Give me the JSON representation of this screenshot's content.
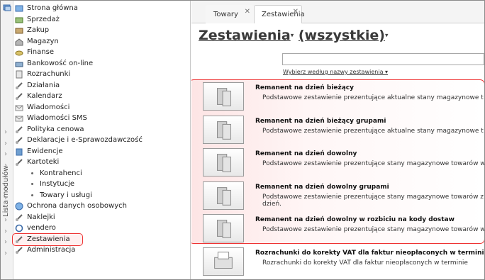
{
  "sidebar": {
    "vertical_label": "Lista modułów",
    "items": [
      {
        "label": "Strona główna"
      },
      {
        "label": "Sprzedaż"
      },
      {
        "label": "Zakup"
      },
      {
        "label": "Magazyn"
      },
      {
        "label": "Finanse"
      },
      {
        "label": "Bankowość on-line"
      },
      {
        "label": "Rozrachunki"
      },
      {
        "label": "Działania"
      },
      {
        "label": "Kalendarz"
      },
      {
        "label": "Wiadomości"
      },
      {
        "label": "Wiadomości SMS"
      },
      {
        "label": "Polityka cenowa"
      },
      {
        "label": "Deklaracje i e-Sprawozdawczość"
      },
      {
        "label": "Ewidencje"
      },
      {
        "label": "Kartoteki"
      },
      {
        "label": "Kontrahenci"
      },
      {
        "label": "Instytucje"
      },
      {
        "label": "Towary i usługi"
      },
      {
        "label": "Ochrona danych osobowych"
      },
      {
        "label": "Naklejki"
      },
      {
        "label": "vendero"
      },
      {
        "label": "Zestawienia"
      },
      {
        "label": "Administracja"
      }
    ]
  },
  "tabs": [
    {
      "label": "Towary",
      "close": "✕"
    },
    {
      "label": "Zestawienia",
      "close": "✕"
    }
  ],
  "header": {
    "title": "Zestawienia",
    "filter": "(wszystkie)",
    "dropdown_glyph": "▾"
  },
  "search": {
    "value": "",
    "hint": "Wybierz według nazwy zestawienia ▾"
  },
  "reports": [
    {
      "title": "Remanent na dzień bieżący",
      "desc": "Podstawowe zestawienie prezentujące aktualne stany magazynowe t"
    },
    {
      "title": "Remanent na dzień bieżący grupami",
      "desc": "Podstawowe zestawienie prezentujące aktualne stany magazynowe t"
    },
    {
      "title": "Remanent na dzień dowolny",
      "desc": "Podstawowe zestawienie prezentujące stany magazynowe towarów w"
    },
    {
      "title": "Remanent na dzień dowolny grupami",
      "desc": "Podstawowe zestawienie prezentujące stany magazynowe towarów z dzień."
    },
    {
      "title": "Remanent na dzień dowolny w rozbiciu na kody dostaw",
      "desc": "Podstawowe zestawienie prezentujące stany magazynowe towarów w"
    },
    {
      "title": "Rozrachunki do korekty VAT dla faktur nieopłaconych w terminie",
      "desc": "Rozrachunki do korekty VAT dla faktur nieopłaconych w terminie"
    }
  ],
  "colors": {
    "highlight_border": "#e33333",
    "highlight_fill": "#fde4e4"
  }
}
